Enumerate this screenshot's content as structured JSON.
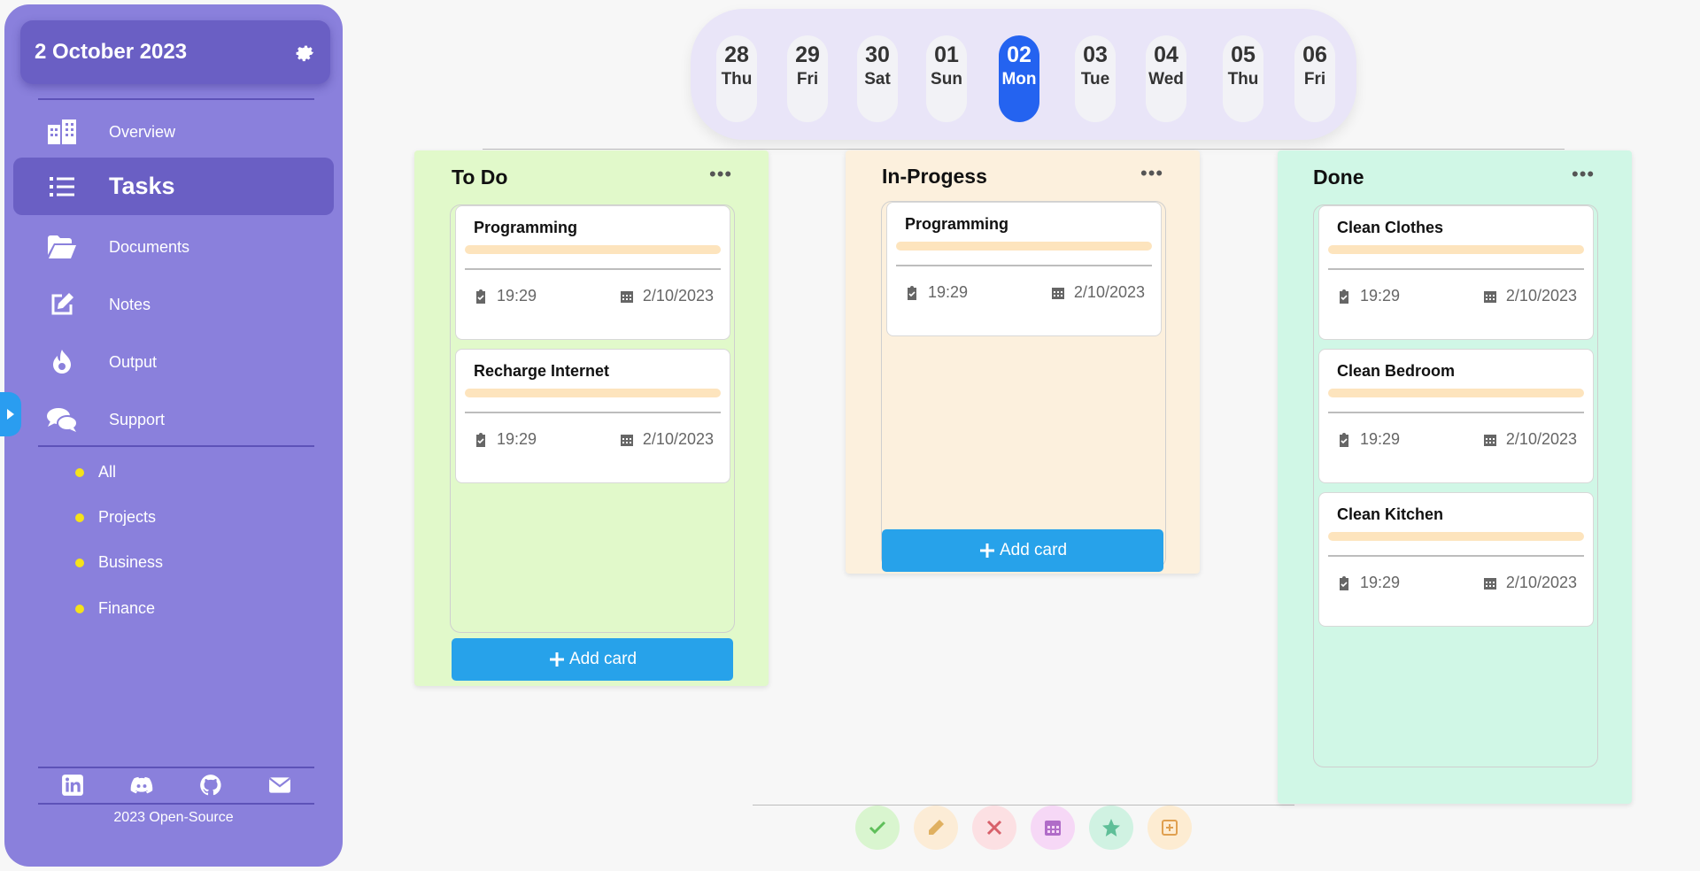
{
  "sidebar": {
    "date": "2 October 2023",
    "nav": [
      {
        "label": "Overview",
        "icon": "building-icon"
      },
      {
        "label": "Tasks",
        "icon": "list-icon"
      },
      {
        "label": "Documents",
        "icon": "folder-open-icon"
      },
      {
        "label": "Notes",
        "icon": "edit-icon"
      },
      {
        "label": "Output",
        "icon": "fire-icon"
      },
      {
        "label": "Support",
        "icon": "comments-icon"
      }
    ],
    "active": "Tasks",
    "subitems": [
      "All",
      "Projects",
      "Business",
      "Finance"
    ],
    "socials": [
      "linkedin-icon",
      "discord-icon",
      "github-icon",
      "envelope-icon"
    ],
    "footer": "2023 Open-Source"
  },
  "dates": [
    {
      "num": "28",
      "wd": "Thu"
    },
    {
      "num": "29",
      "wd": "Fri"
    },
    {
      "num": "30",
      "wd": "Sat"
    },
    {
      "num": "01",
      "wd": "Sun"
    },
    {
      "num": "02",
      "wd": "Mon",
      "selected": true
    },
    {
      "num": "03",
      "wd": "Tue"
    },
    {
      "num": "04",
      "wd": "Wed"
    },
    {
      "num": "05",
      "wd": "Thu"
    },
    {
      "num": "06",
      "wd": "Fri"
    }
  ],
  "columns": [
    {
      "title": "To Do",
      "color": "#e1f9ca",
      "cards": [
        {
          "title": "Programming",
          "time": "19:29",
          "date": "2/10/2023"
        },
        {
          "title": "Recharge Internet",
          "time": "19:29",
          "date": "2/10/2023"
        }
      ],
      "add_label": "Add card"
    },
    {
      "title": "In-Progess",
      "color": "#fcf0dd",
      "cards": [
        {
          "title": "Programming",
          "time": "19:29",
          "date": "2/10/2023"
        }
      ],
      "add_label": "Add card"
    },
    {
      "title": "Done",
      "color": "#d0f7e6",
      "cards": [
        {
          "title": "Clean Clothes",
          "time": "19:29",
          "date": "2/10/2023"
        },
        {
          "title": "Clean Bedroom",
          "time": "19:29",
          "date": "2/10/2023"
        },
        {
          "title": "Clean Kitchen",
          "time": "19:29",
          "date": "2/10/2023"
        }
      ]
    }
  ],
  "toolbar": [
    {
      "icon": "check-icon",
      "bg": "#d9f5cf",
      "fg": "#5fbf5a"
    },
    {
      "icon": "pencil-icon",
      "bg": "#fcecd6",
      "fg": "#e0b060"
    },
    {
      "icon": "close-icon",
      "bg": "#fce0e3",
      "fg": "#d8606a"
    },
    {
      "icon": "calendar-icon",
      "bg": "#f6d8f6",
      "fg": "#b06cc8"
    },
    {
      "icon": "star-icon",
      "bg": "#d0f2e2",
      "fg": "#5fbf98"
    },
    {
      "icon": "add-square-icon",
      "bg": "#fdecd2",
      "fg": "#e0a050"
    }
  ],
  "colors": {
    "sidebar": "#8a80dc",
    "sidebar_dark": "#6a5fc4",
    "accent_blue": "#27a2ea",
    "selected_day": "#2463f0"
  }
}
